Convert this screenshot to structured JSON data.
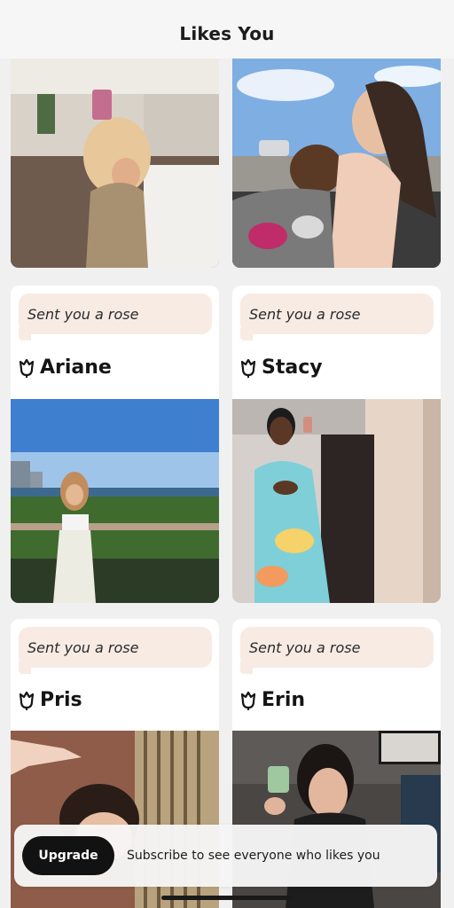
{
  "header": {
    "title": "Likes You"
  },
  "cards": [
    {
      "bubble": "Sent you a rose",
      "name": "Ariane",
      "icon": "rose-icon"
    },
    {
      "bubble": "Sent you a rose",
      "name": "Stacy",
      "icon": "rose-icon"
    },
    {
      "bubble": "Sent you a rose",
      "name": "Pris",
      "icon": "rose-icon"
    },
    {
      "bubble": "Sent you a rose",
      "name": "Erin",
      "icon": "rose-icon"
    }
  ],
  "upgrade": {
    "button_label": "Upgrade",
    "message": "Subscribe to see everyone who likes you"
  },
  "colors": {
    "bubble": "#f7ebe4",
    "button": "#121212",
    "background": "#f1f0f0"
  }
}
